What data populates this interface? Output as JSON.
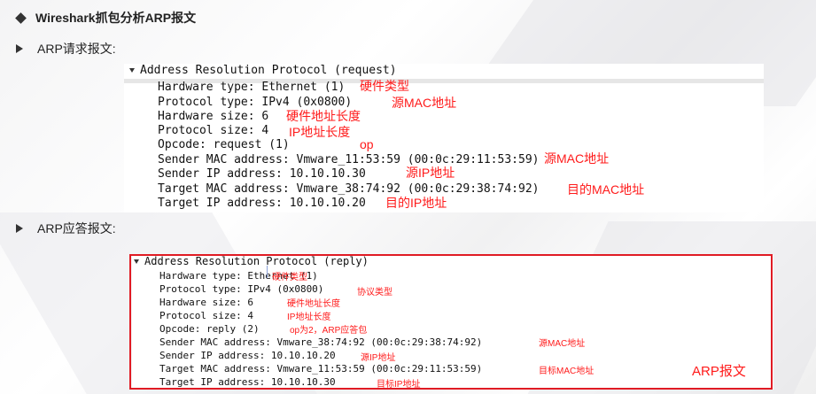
{
  "title": "Wireshark抓包分析ARP报文",
  "request_heading": "ARP请求报文:",
  "reply_heading": "ARP应答报文:",
  "request": {
    "header": "Address Resolution Protocol (request)",
    "fields": [
      "Hardware type: Ethernet (1)",
      "Protocol type: IPv4 (0x0800)",
      "Hardware size: 6",
      "Protocol size: 4",
      "Opcode: request (1)",
      "Sender MAC address: Vmware_11:53:59 (00:0c:29:11:53:59)",
      "Sender IP address: 10.10.10.30",
      "Target MAC address: Vmware_38:74:92 (00:0c:29:38:74:92)",
      "Target IP address: 10.10.10.20"
    ],
    "notes": [
      "硬件类型",
      "源MAC地址",
      "硬件地址长度",
      "IP地址长度",
      "op",
      "源MAC地址",
      "源IP地址",
      "目的MAC地址",
      "目的IP地址"
    ]
  },
  "reply": {
    "header": "Address Resolution Protocol (reply)",
    "fields": [
      "Hardware type: Ethernet (1)",
      "Protocol type: IPv4 (0x0800)",
      "Hardware size: 6",
      "Protocol size: 4",
      "Opcode: reply (2)",
      "Sender MAC address: Vmware_38:74:92 (00:0c:29:38:74:92)",
      "Sender IP address: 10.10.10.20",
      "Target MAC address: Vmware_11:53:59 (00:0c:29:11:53:59)",
      "Target IP address: 10.10.10.30"
    ],
    "notes": [
      "硬件类型",
      "协议类型",
      "硬件地址长度",
      "IP地址长度",
      "op为2，ARP应答包",
      "源MAC地址",
      "源IP地址",
      "目标MAC地址",
      "目标IP地址"
    ],
    "frame_label": "ARP报文"
  },
  "colors": {
    "annotation": "#ff1a1a",
    "frame": "#e01b24"
  }
}
